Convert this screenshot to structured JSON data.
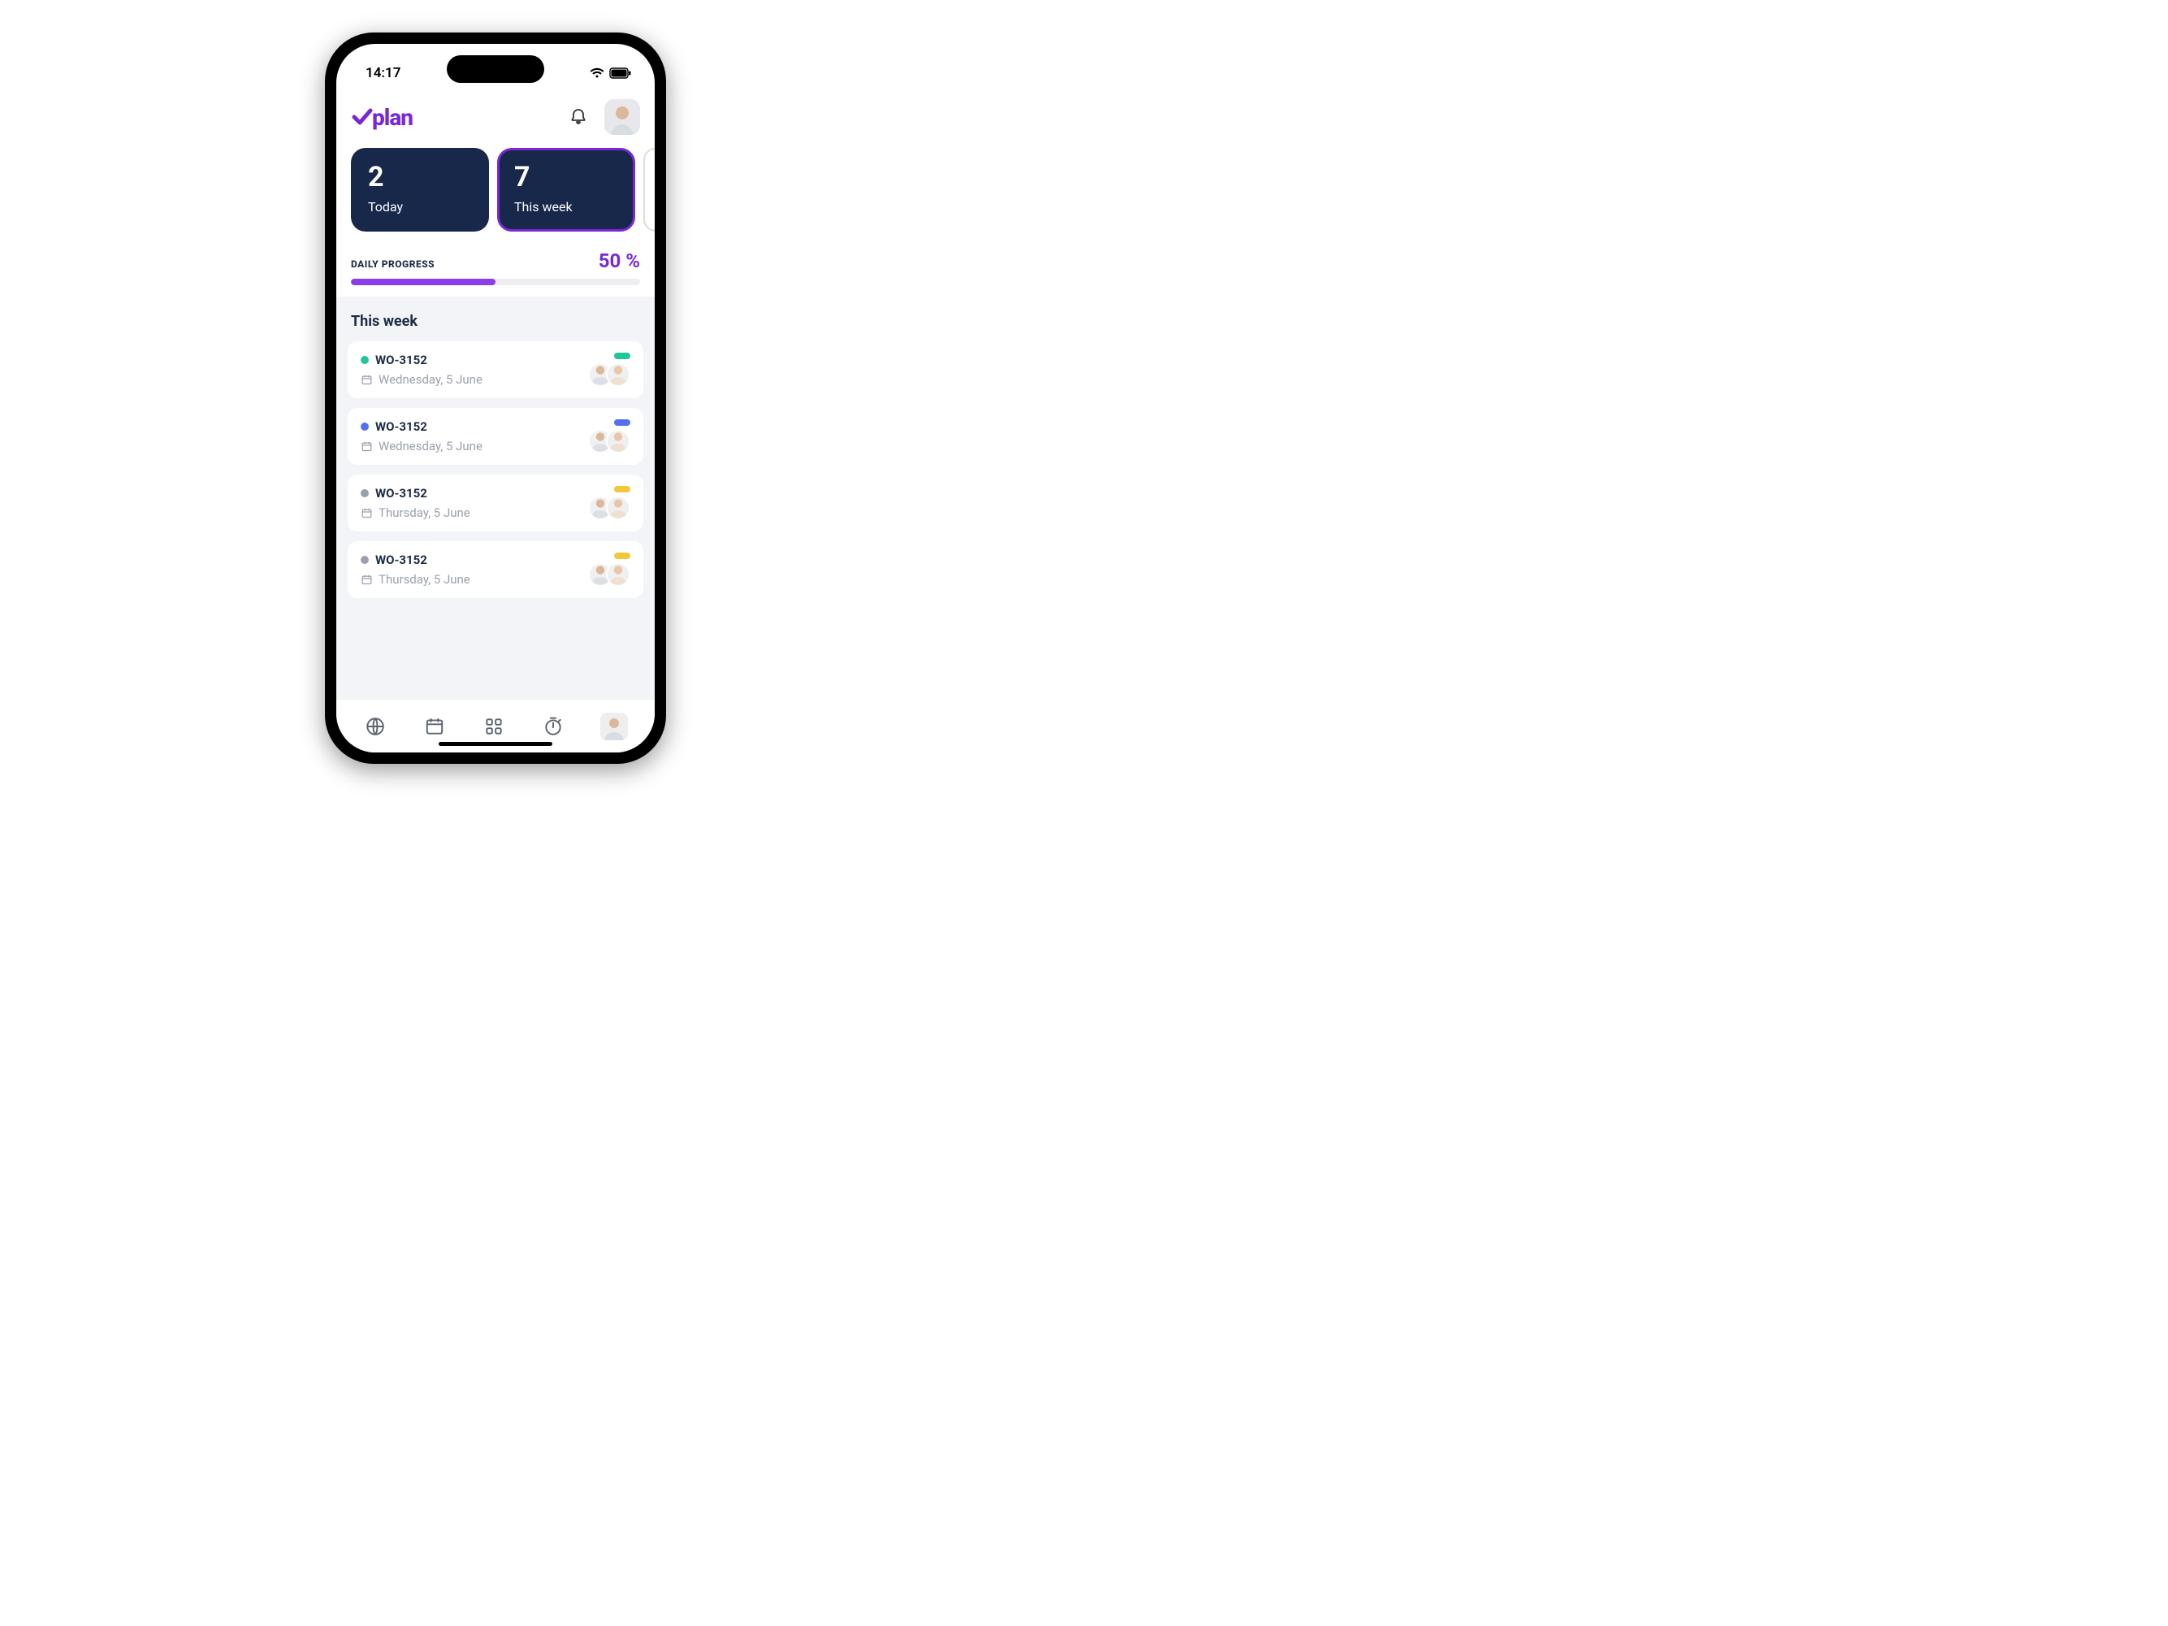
{
  "status": {
    "time": "14:17"
  },
  "header": {
    "brand": "plan"
  },
  "stats": {
    "cards": [
      {
        "value": "2",
        "label": "Today",
        "active": false
      },
      {
        "value": "7",
        "label": "This week",
        "active": true
      }
    ]
  },
  "progress": {
    "title": "DAILY PROGRESS",
    "percent_label": "50 %",
    "percent_value": 50
  },
  "list": {
    "title": "This week",
    "items": [
      {
        "title": "WO-3152",
        "date": "Wednesday, 5 June",
        "dot_color": "c-green",
        "pill_color": "c-green"
      },
      {
        "title": "WO-3152",
        "date": "Wednesday, 5 June",
        "dot_color": "c-blue",
        "pill_color": "c-blue"
      },
      {
        "title": "WO-3152",
        "date": "Thursday, 5 June",
        "dot_color": "c-grey",
        "pill_color": "c-yellow"
      },
      {
        "title": "WO-3152",
        "date": "Thursday, 5 June",
        "dot_color": "c-grey",
        "pill_color": "c-yellow"
      }
    ]
  }
}
